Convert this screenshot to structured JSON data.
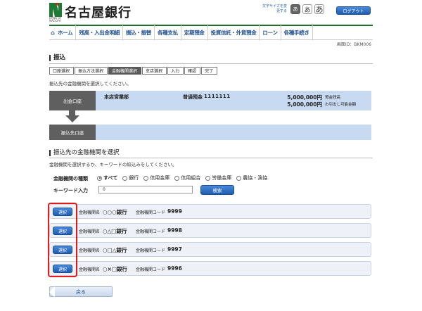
{
  "header": {
    "logo_text": "名古屋銀行",
    "logo_sub": "BANK OF NAGOYA",
    "fontsize_label": "文字サイズを変更する",
    "font_buttons": [
      "あ",
      "あ",
      "あ"
    ],
    "logout": "ログアウト"
  },
  "nav": {
    "home": "ホーム",
    "items": [
      "残高・入出金明細",
      "振込・振替",
      "各種支払",
      "定期預金",
      "投資信託・外貨預金",
      "ローン",
      "各種手続き"
    ]
  },
  "screen_id": "画面ID：BKM006",
  "page_title": "振込",
  "steps": [
    "口座選択",
    "振込方法選択",
    "金融機関選択",
    "支店選択",
    "入力",
    "確認",
    "完了"
  ],
  "instruction1": "振込先の金融機関を選択してください。",
  "account": {
    "label": "出金口座",
    "branch": "本店営業部",
    "type": "普通預金",
    "number": "1111111",
    "balance": "5,000,000円",
    "balance_label": "預金残高",
    "available": "5,000,000円",
    "available_label": "お引出し可能金額"
  },
  "destination": {
    "label": "振込先口座"
  },
  "section_title": "振込先の金融機関を選択",
  "instruction2": "金融機関を選択するか、キーワードの絞込みをしてください。",
  "filter": {
    "type_label": "金融機関の種類",
    "options": [
      "すべて",
      "銀行",
      "信用金庫",
      "信用組合",
      "労働金庫",
      "農協・漁協"
    ],
    "keyword_label": "キーワード入力",
    "keyword_value": "0",
    "search_button": "検索"
  },
  "results": [
    {
      "select": "選択",
      "name_label": "金融機関名",
      "name": "○○○銀行",
      "code_label": "金融機関コード",
      "code": "9999"
    },
    {
      "select": "選択",
      "name_label": "金融機関名",
      "name": "○△□銀行",
      "code_label": "金融機関コード",
      "code": "9998"
    },
    {
      "select": "選択",
      "name_label": "金融機関名",
      "name": "○□△銀行",
      "code_label": "金融機関コード",
      "code": "9997"
    },
    {
      "select": "選択",
      "name_label": "金融機関名",
      "name": "○×□銀行",
      "code_label": "金融機関コード",
      "code": "9996"
    }
  ],
  "back_button": "戻る",
  "colors": {
    "brand_green": "#1f6f2f",
    "button_blue": "#1e5cb0",
    "panel_blue": "#c7daf1",
    "highlight_red": "#e21b1b"
  }
}
